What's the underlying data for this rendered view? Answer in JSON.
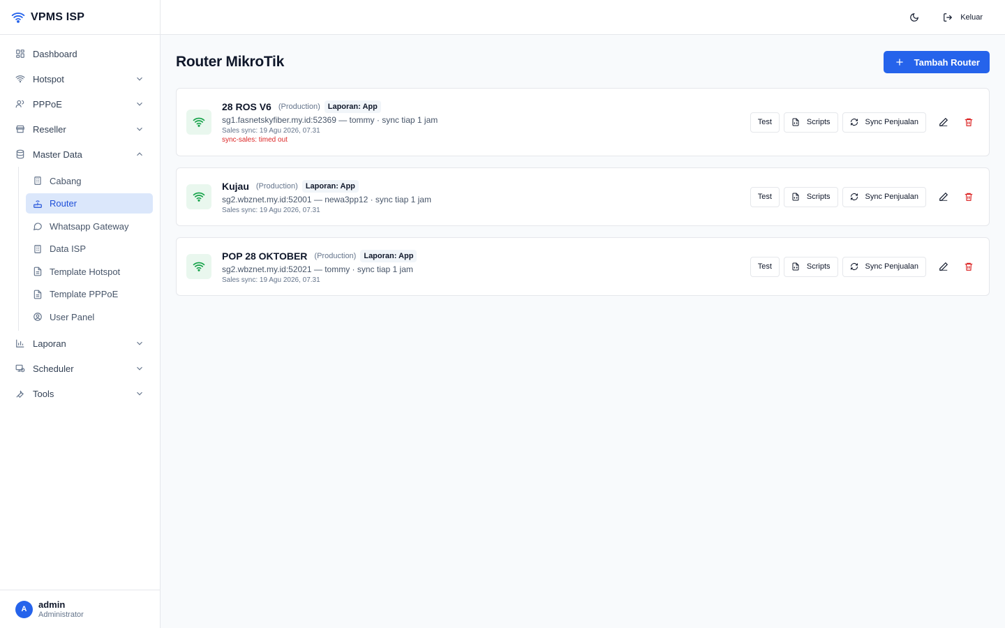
{
  "brand": {
    "title": "VPMS ISP"
  },
  "sidebar": {
    "items": [
      {
        "label": "Dashboard"
      },
      {
        "label": "Hotspot"
      },
      {
        "label": "PPPoE"
      },
      {
        "label": "Reseller"
      },
      {
        "label": "Master Data"
      },
      {
        "label": "Laporan"
      },
      {
        "label": "Scheduler"
      },
      {
        "label": "Tools"
      }
    ],
    "master_data_sub": [
      {
        "label": "Cabang"
      },
      {
        "label": "Router"
      },
      {
        "label": "Whatsapp Gateway"
      },
      {
        "label": "Data ISP"
      },
      {
        "label": "Template Hotspot"
      },
      {
        "label": "Template PPPoE"
      },
      {
        "label": "User Panel"
      }
    ]
  },
  "user": {
    "initial": "A",
    "name": "admin",
    "role": "Administrator"
  },
  "topbar": {
    "logout_label": "Keluar"
  },
  "page": {
    "title": "Router MikroTik",
    "add_button": "Tambah Router"
  },
  "actions": {
    "test": "Test",
    "scripts": "Scripts",
    "sync": "Sync Penjualan"
  },
  "routers": [
    {
      "name": "28 ROS V6",
      "env": "(Production)",
      "badge": "Laporan: App",
      "host": "sg1.fasnetskyfiber.my.id:52369 — tommy · sync tiap 1 jam",
      "sales": "Sales sync: 19 Agu 2026, 07.31",
      "error": "sync-sales: timed out"
    },
    {
      "name": "Kujau",
      "env": "(Production)",
      "badge": "Laporan: App",
      "host": "sg2.wbznet.my.id:52001 — newa3pp12 · sync tiap 1 jam",
      "sales": "Sales sync: 19 Agu 2026, 07.31"
    },
    {
      "name": "POP 28 OKTOBER",
      "env": "(Production)",
      "badge": "Laporan: App",
      "host": "sg2.wbznet.my.id:52021 — tommy · sync tiap 1 jam",
      "sales": "Sales sync: 19 Agu 2026, 07.31"
    }
  ],
  "colors": {
    "primary": "#2563eb",
    "active_bg": "#dbe7fb",
    "success_bg": "#e9f7ee",
    "success": "#16a34a",
    "danger": "#dc2626"
  }
}
